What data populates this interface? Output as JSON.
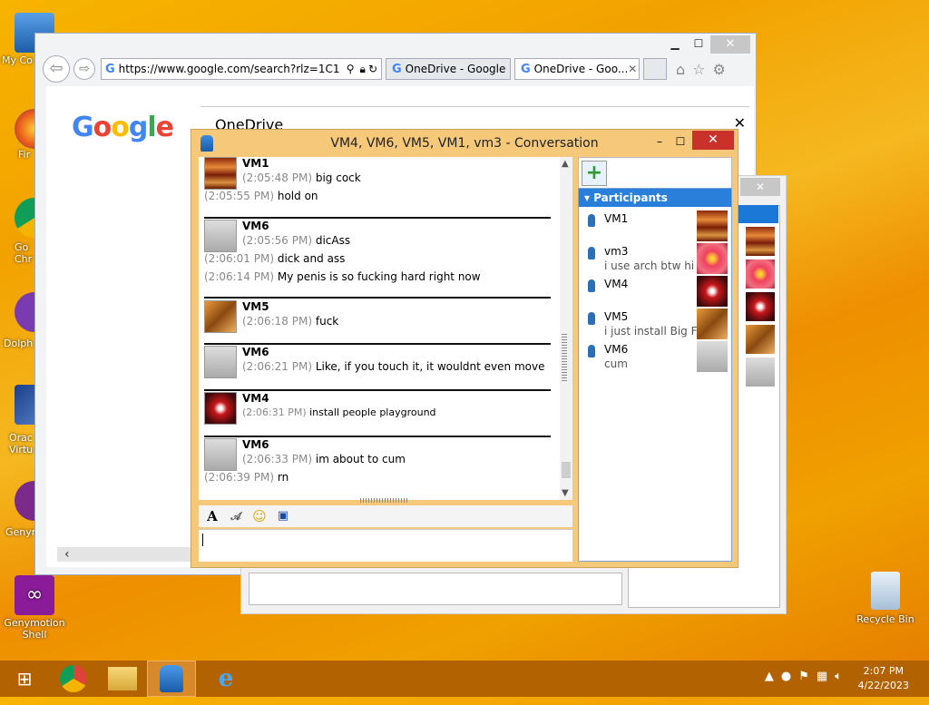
{
  "desktop": {
    "icons": [
      {
        "label": "My Co"
      },
      {
        "label": "Fir"
      },
      {
        "label": "Go Chr"
      },
      {
        "label": "Dolph"
      },
      {
        "label": "Orac Virtu"
      },
      {
        "label": "Genyr"
      },
      {
        "label": "Genymotion Shell"
      }
    ],
    "recycle_bin": "Recycle Bin"
  },
  "ie": {
    "url": "https://www.google.com/search?rlz=1C1",
    "tabs": [
      "OneDrive - Google ...",
      "OneDrive - Goo..."
    ],
    "google_logo": "Google",
    "onedrive_title": "OneDrive"
  },
  "conversation": {
    "title": "VM4, VM6, VM5, VM1, vm3 - Conversation",
    "groups": [
      {
        "name": "VM1",
        "lines": [
          {
            "t": "(2:05:48 PM)",
            "m": "big cock"
          },
          {
            "t": "(2:05:55 PM)",
            "m": "hold on"
          }
        ]
      },
      {
        "name": "VM6",
        "lines": [
          {
            "t": "(2:05:56 PM)",
            "m": "dicAss"
          },
          {
            "t": "(2:06:01 PM)",
            "m": "dick and ass"
          },
          {
            "t": "(2:06:14 PM)",
            "m": "My penis is so fucking hard right now"
          }
        ]
      },
      {
        "name": "VM5",
        "lines": [
          {
            "t": "(2:06:18 PM)",
            "m": "fuck"
          }
        ]
      },
      {
        "name": "VM6",
        "lines": [
          {
            "t": "(2:06:21 PM)",
            "m": "Like, if you touch it, it wouldnt even move"
          }
        ]
      },
      {
        "name": "VM4",
        "lines": [
          {
            "t": "(2:06:31 PM)",
            "m": "install people playground"
          }
        ]
      },
      {
        "name": "VM6",
        "lines": [
          {
            "t": "(2:06:33 PM)",
            "m": "im about to cum"
          },
          {
            "t": "(2:06:39 PM)",
            "m": "rn"
          }
        ]
      }
    ],
    "participants_header": "Participants",
    "participants": [
      {
        "name": "VM1",
        "status": ""
      },
      {
        "name": "vm3",
        "status": "i use arch btw hi"
      },
      {
        "name": "VM4",
        "status": ""
      },
      {
        "name": "VM5",
        "status": "i just install Big F..."
      },
      {
        "name": "VM6",
        "status": "cum"
      }
    ]
  },
  "taskbar": {
    "time": "2:07 PM",
    "date": "4/22/2023"
  }
}
